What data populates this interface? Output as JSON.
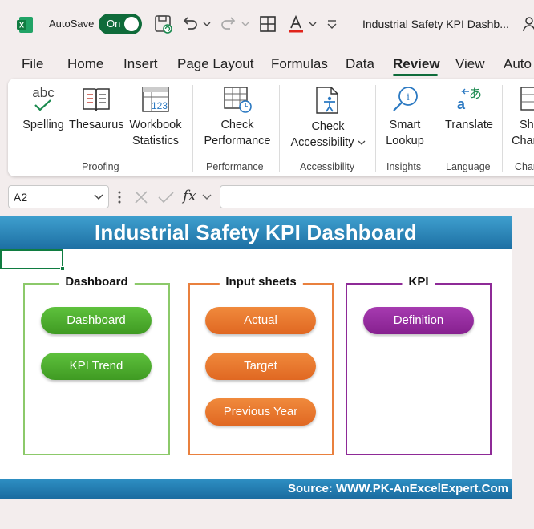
{
  "titlebar": {
    "autosave_label": "AutoSave",
    "autosave_state": "On",
    "document_title": "Industrial Safety KPI Dashb..."
  },
  "tabs": [
    "File",
    "Home",
    "Insert",
    "Page Layout",
    "Formulas",
    "Data",
    "Review",
    "View",
    "Auto"
  ],
  "active_tab": "Review",
  "ribbon": {
    "proofing": {
      "label": "Proofing",
      "spelling_icon_text": "abc",
      "spelling": "Spelling",
      "thesaurus": "Thesaurus",
      "workbook_statistics_line1": "Workbook",
      "workbook_statistics_line2": "Statistics",
      "workbook_statistics_icon_text": "123"
    },
    "performance": {
      "label": "Performance",
      "check_performance_line1": "Check",
      "check_performance_line2": "Performance"
    },
    "accessibility": {
      "label": "Accessibility",
      "check_accessibility_line1": "Check",
      "check_accessibility_line2": "Accessibility"
    },
    "insights": {
      "label": "Insights",
      "smart_lookup_line1": "Smart",
      "smart_lookup_line2": "Lookup"
    },
    "language": {
      "label": "Language",
      "translate": "Translate"
    },
    "changes": {
      "label": "Chan",
      "show_changes_line1": "Sh",
      "show_changes_line2": "Chan"
    }
  },
  "formula_bar": {
    "name_box": "A2",
    "fx": "fx",
    "formula": ""
  },
  "sheet": {
    "banner_title": "Industrial Safety KPI Dashboard",
    "footer_source": "Source: WWW.PK-AnExcelExpert.Com",
    "panels": {
      "dashboard": {
        "title": "Dashboard",
        "color": "#8cc96a",
        "buttons": [
          "Dashboard",
          "KPI Trend"
        ]
      },
      "input_sheets": {
        "title": "Input sheets",
        "color": "#e9803e",
        "buttons": [
          "Actual",
          "Target",
          "Previous Year"
        ]
      },
      "kpi": {
        "title": "KPI",
        "color": "#8e2a97",
        "buttons": [
          "Definition"
        ]
      }
    }
  },
  "colors": {
    "excel_green": "#107c41",
    "banner_blue": "#2582b8",
    "pill_green": "#4faa2e",
    "pill_orange": "#e8762c",
    "pill_purple": "#962a9f"
  }
}
